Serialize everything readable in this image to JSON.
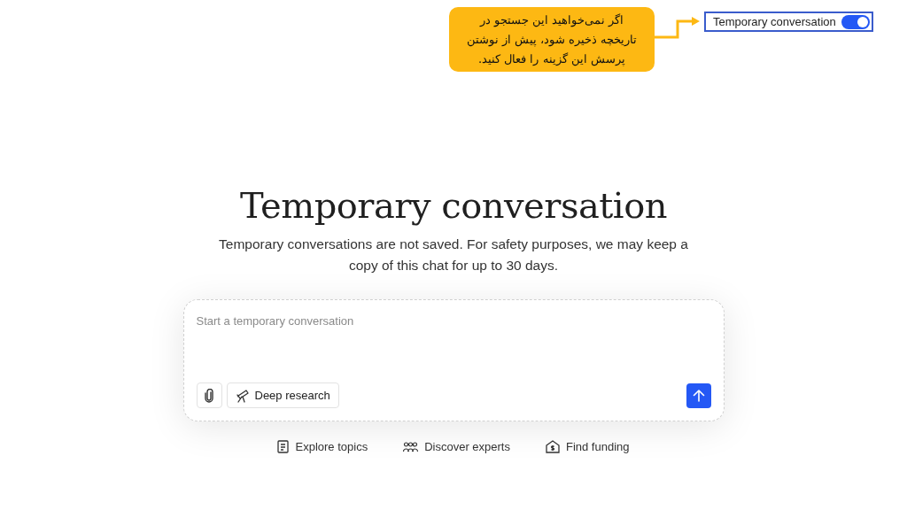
{
  "annotation": {
    "lines": [
      "اگر نمی‌خواهید این جستجو در",
      "تاریخچه ذخیره شود، پیش از نوشتن",
      "پرسش این گزینه را فعال کنید."
    ]
  },
  "temporary_toggle": {
    "label": "Temporary conversation",
    "on": true
  },
  "heading": "Temporary conversation",
  "description": "Temporary conversations are not saved. For safety purposes, we may keep a copy of this chat for up to 30 days.",
  "composer": {
    "placeholder": "Start a temporary conversation",
    "deep_research": {
      "label": "Deep research",
      "selected": false
    }
  },
  "suggestions": [
    {
      "kind": "topics",
      "label": "Explore topics"
    },
    {
      "kind": "experts",
      "label": "Discover experts"
    },
    {
      "kind": "funding",
      "label": "Find funding"
    }
  ]
}
